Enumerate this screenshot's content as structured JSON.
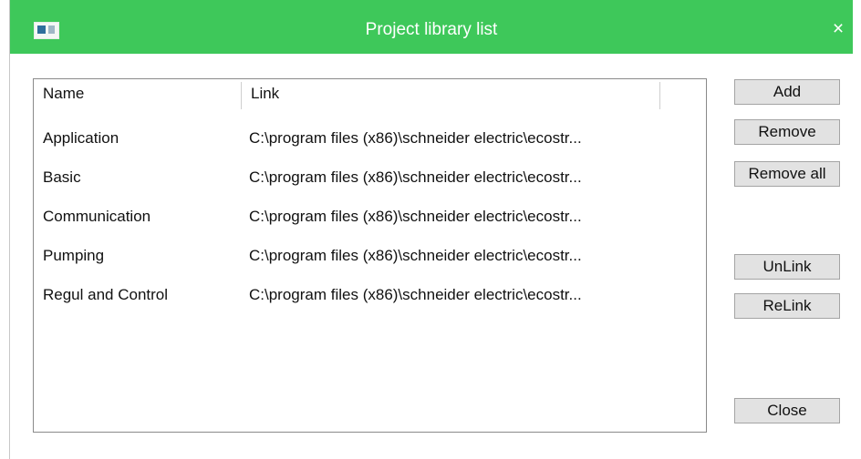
{
  "window": {
    "title": "Project library list",
    "close_glyph": "×",
    "icon": "app-window-icon"
  },
  "table": {
    "columns": [
      "Name",
      "Link"
    ],
    "rows": [
      {
        "name": "Application",
        "link": "C:\\program files (x86)\\schneider electric\\ecostr..."
      },
      {
        "name": "Basic",
        "link": "C:\\program files (x86)\\schneider electric\\ecostr..."
      },
      {
        "name": "Communication",
        "link": "C:\\program files (x86)\\schneider electric\\ecostr..."
      },
      {
        "name": "Pumping",
        "link": "C:\\program files (x86)\\schneider electric\\ecostr..."
      },
      {
        "name": "Regul and Control",
        "link": "C:\\program files (x86)\\schneider electric\\ecostr..."
      }
    ]
  },
  "buttons": {
    "add": "Add",
    "remove": "Remove",
    "remove_all": "Remove all",
    "unlink": "UnLink",
    "relink": "ReLink",
    "close": "Close"
  },
  "colors": {
    "titlebar": "#3ec85a"
  }
}
